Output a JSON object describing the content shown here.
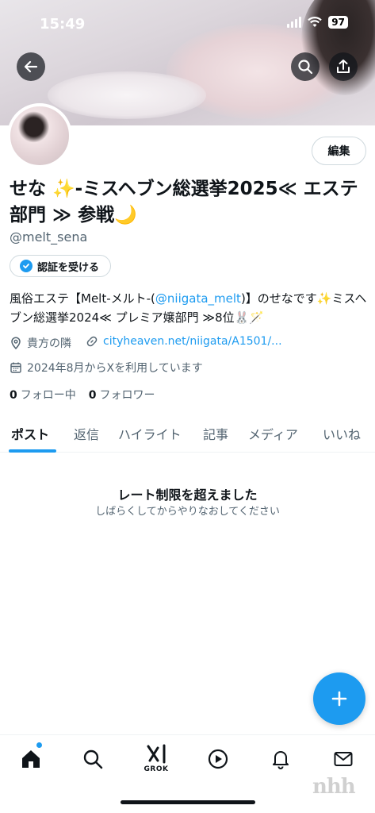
{
  "status_bar": {
    "time": "15:49",
    "battery": "97"
  },
  "profile": {
    "edit_label": "編集",
    "display_name": "せな ✨-ミスヘブン総選挙2025≪ エステ部門 ≫ 参戦🌙",
    "handle": "@melt_sena",
    "verify_label": "認証を受ける",
    "bio_prefix": "風俗エステ【Melt-メルト-(",
    "bio_mention": "@niigata_melt",
    "bio_suffix": ")】のせなです✨ミスヘブン総選挙2024≪ プレミア嬢部門 ≫8位🐰🪄",
    "location": "貴方の隣",
    "website": "cityheaven.net/niigata/A1501/...",
    "joined": "2024年8月からXを利用しています",
    "following_count": "0",
    "following_label": "フォロー中",
    "followers_count": "0",
    "followers_label": "フォロワー"
  },
  "tabs": [
    "ポスト",
    "返信",
    "ハイライト",
    "記事",
    "メディア",
    "いいね"
  ],
  "empty_state": {
    "title": "レート制限を超えました",
    "subtitle": "しばらくしてからやりなおしてください"
  },
  "bottom_nav": {
    "grok_label": "GROK"
  },
  "watermark": "nhh",
  "colors": {
    "accent": "#1d9bf0",
    "text": "#0f1419",
    "muted": "#536471",
    "border": "#cfd9de"
  }
}
